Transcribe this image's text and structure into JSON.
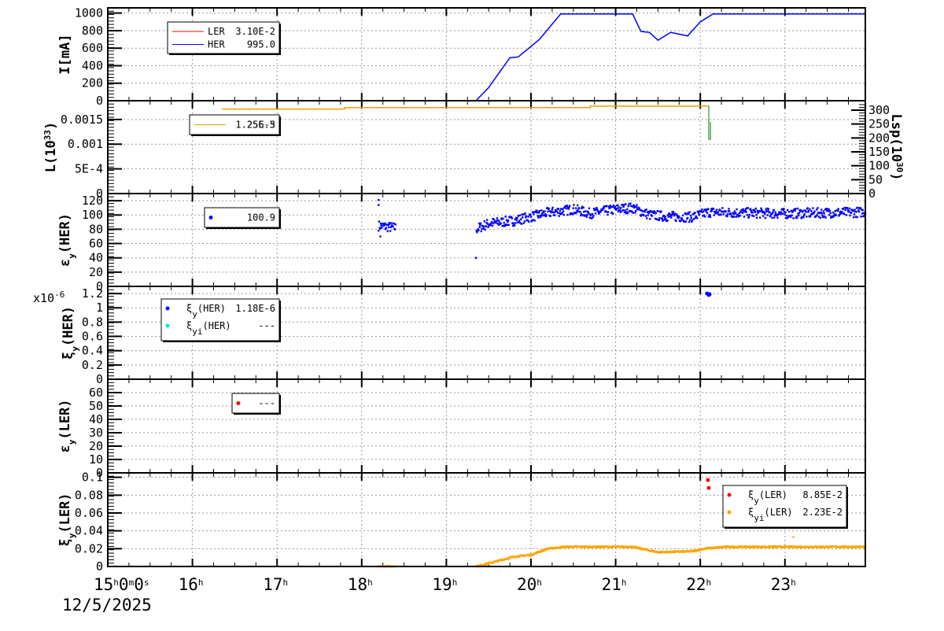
{
  "chart_data": {
    "type": "line",
    "x_unit": "hour",
    "xlim": [
      15,
      23.95
    ],
    "x_ticks": [
      {
        "h": 15,
        "label": "15",
        "sup": "h",
        "tail": "0",
        "sup2": "m",
        "tail2": "0",
        "sup3": "s"
      },
      {
        "h": 16,
        "label": "16",
        "sup": "h"
      },
      {
        "h": 17,
        "label": "17",
        "sup": "h"
      },
      {
        "h": 18,
        "label": "18",
        "sup": "h"
      },
      {
        "h": 19,
        "label": "19",
        "sup": "h"
      },
      {
        "h": 20,
        "label": "20",
        "sup": "h"
      },
      {
        "h": 21,
        "label": "21",
        "sup": "h"
      },
      {
        "h": 22,
        "label": "22",
        "sup": "h"
      },
      {
        "h": 23,
        "label": "23",
        "sup": "h"
      }
    ],
    "date_label": "12/5/2025",
    "panels": [
      {
        "id": "current",
        "ylabel": "I[mA]",
        "ylim": [
          0,
          1060
        ],
        "yticks": [
          "0",
          "200",
          "400",
          "600",
          "800",
          "1000"
        ],
        "ytick_values": [
          0,
          200,
          400,
          600,
          800,
          1000
        ],
        "legend": [
          {
            "name": "LER",
            "value": "3.10E-2",
            "color": "#ff0000",
            "mark": "line"
          },
          {
            "name": "HER",
            "value": "995.0",
            "color": "#0000ff",
            "mark": "line"
          }
        ],
        "series": [
          {
            "name": "HER",
            "color": "#0000ff",
            "kind": "line",
            "x": [
              15,
              19.35,
              19.5,
              19.75,
              19.85,
              20.1,
              20.35,
              21.2,
              21.3,
              21.4,
              21.5,
              21.65,
              21.75,
              21.85,
              22.0,
              22.15,
              23.95
            ],
            "y": [
              0,
              0,
              150,
              490,
              500,
              700,
              990,
              990,
              790,
              780,
              690,
              780,
              760,
              740,
              900,
              990,
              990
            ]
          },
          {
            "name": "LER",
            "color": "#ff0000",
            "kind": "line",
            "x": [
              19.35,
              23.95
            ],
            "y": [
              0,
              0
            ]
          }
        ]
      },
      {
        "id": "luminosity",
        "ylabel": "L(10",
        "ylabel_sup": "33",
        "ylabel_tail": ")",
        "ylim": [
          0,
          0.00188
        ],
        "yticks": [
          "0",
          "5E-4",
          "0.001",
          "0.0015"
        ],
        "ytick_values": [
          0,
          0.0005,
          0.001,
          0.0015
        ],
        "right_axis": {
          "label": "Lsp(10",
          "sup": "30",
          "tail": ")",
          "ylim": [
            0,
            334
          ],
          "yticks": [
            "0",
            "50",
            "100",
            "150",
            "200",
            "250",
            "300"
          ],
          "ytick_values": [
            0,
            50,
            100,
            150,
            200,
            250,
            300
          ]
        },
        "legend": [
          {
            "name": "",
            "value": "1.25E-3",
            "value2": "256.5",
            "color": "#e8a000",
            "mark": "line"
          }
        ],
        "series": [
          {
            "name": "L",
            "color": "#e8a000",
            "kind": "line",
            "x": [
              16.35,
              17.8,
              17.8,
              20.7,
              20.7,
              22.1
            ],
            "y": [
              0.00171,
              0.00171,
              0.00174,
              0.00174,
              0.00177,
              0.00177
            ]
          },
          {
            "name": "Lsp",
            "color": "#008000",
            "kind": "spike",
            "x": [
              22.1,
              22.1,
              22.12,
              22.12
            ],
            "y": [
              0.00177,
              0.0011,
              0.0011,
              0.00145
            ]
          }
        ]
      },
      {
        "id": "emittance_her",
        "ylabel": "ε",
        "ylabel_sub": "y",
        "ylabel_tail": "(HER)",
        "ylim": [
          0,
          130
        ],
        "yticks": [
          "0",
          "20",
          "40",
          "60",
          "80",
          "100",
          "120"
        ],
        "ytick_values": [
          0,
          20,
          40,
          60,
          80,
          100,
          120
        ],
        "legend": [
          {
            "name": "",
            "value": "100.9",
            "color": "#0000ff",
            "mark": "dot"
          }
        ],
        "series": [
          {
            "name": "ε_y(HER)",
            "color": "#0000ff",
            "kind": "scatter_trend",
            "x": [
              18.2,
              18.4,
              19.35,
              19.5,
              19.8,
              20.2,
              20.5,
              20.7,
              21.0,
              21.2,
              21.4,
              21.6,
              21.9,
              22.1,
              22.5,
              23.0,
              23.95
            ],
            "y": [
              85,
              82,
              80,
              88,
              92,
              103,
              108,
              102,
              108,
              110,
              100,
              98,
              97,
              104,
              103,
              102,
              104
            ],
            "noise": 7,
            "gaps": [
              [
                18.4,
                19.35
              ]
            ],
            "extra_points": [
              [
                18.2,
                121
              ],
              [
                18.2,
                114
              ],
              [
                18.22,
                70
              ],
              [
                19.35,
                40
              ]
            ]
          }
        ]
      },
      {
        "id": "tuneshift_her",
        "ylabel": "ξ",
        "ylabel_sub": "y",
        "ylabel_tail": "(HER)",
        "scale_label": "x10",
        "scale_sup": "-6",
        "ylim": [
          0,
          1.3
        ],
        "yticks": [
          "0",
          "0.2",
          "0.4",
          "0.6",
          "0.8",
          "1",
          "1.2"
        ],
        "ytick_values": [
          0,
          0.2,
          0.4,
          0.6,
          0.8,
          1,
          1.2
        ],
        "legend": [
          {
            "name": "ξ",
            "sub": "y",
            "tail": "(HER)",
            "value": "1.18E-6",
            "color": "#0000ff",
            "mark": "dot"
          },
          {
            "name": "ξ",
            "sub": "yi",
            "tail": "(HER)",
            "value": "---",
            "color": "#00e5e5",
            "mark": "dot"
          }
        ],
        "series": [
          {
            "name": "ξ_y(HER)",
            "color": "#0000ff",
            "kind": "scatter",
            "x": [
              22.08,
              22.1,
              22.11
            ],
            "y": [
              1.2,
              1.18,
              1.19
            ]
          }
        ]
      },
      {
        "id": "emittance_ler",
        "ylabel": "ε",
        "ylabel_sub": "y",
        "ylabel_tail": "(LER)",
        "ylim": [
          0,
          70
        ],
        "yticks": [
          "0",
          "10",
          "20",
          "30",
          "40",
          "50",
          "60"
        ],
        "ytick_values": [
          0,
          10,
          20,
          30,
          40,
          50,
          60
        ],
        "legend": [
          {
            "name": "",
            "value": "---",
            "color": "#ff0000",
            "mark": "dot"
          }
        ],
        "series": []
      },
      {
        "id": "tuneshift_ler",
        "ylabel": "ξ",
        "ylabel_sub": "y",
        "ylabel_tail": "(LER)",
        "ylim": [
          0,
          0.105
        ],
        "yticks": [
          "0",
          "0.02",
          "0.04",
          "0.06",
          "0.08",
          "0.1"
        ],
        "ytick_values": [
          0,
          0.02,
          0.04,
          0.06,
          0.08,
          0.1
        ],
        "legend": [
          {
            "name": "ξ",
            "sub": "y",
            "tail": "(LER)",
            "value": "8.85E-2",
            "color": "#ff0000",
            "mark": "dot"
          },
          {
            "name": "ξ",
            "sub": "yi",
            "tail": "(LER)",
            "value": "2.23E-2",
            "color": "#ffa500",
            "mark": "dot"
          }
        ],
        "series": [
          {
            "name": "ξ_y(LER)",
            "color": "#ff0000",
            "kind": "scatter",
            "x": [
              22.09,
              22.1
            ],
            "y": [
              0.097,
              0.088
            ]
          },
          {
            "name": "ξ_yi(LER)",
            "color": "#ffa500",
            "kind": "scatter_trend",
            "x": [
              18.2,
              18.4,
              19.35,
              19.6,
              19.8,
              20.0,
              20.2,
              20.4,
              21.2,
              21.3,
              21.5,
              21.9,
              22.05,
              22.3,
              23.95
            ],
            "y": [
              0,
              0,
              0,
              0.006,
              0.011,
              0.013,
              0.02,
              0.022,
              0.022,
              0.02,
              0.016,
              0.017,
              0.02,
              0.022,
              0.022
            ],
            "noise": 0.0008,
            "gaps": [
              [
                18.4,
                19.35
              ]
            ],
            "extra_points": [
              [
                23.1,
                0.033
              ]
            ]
          }
        ]
      }
    ]
  }
}
